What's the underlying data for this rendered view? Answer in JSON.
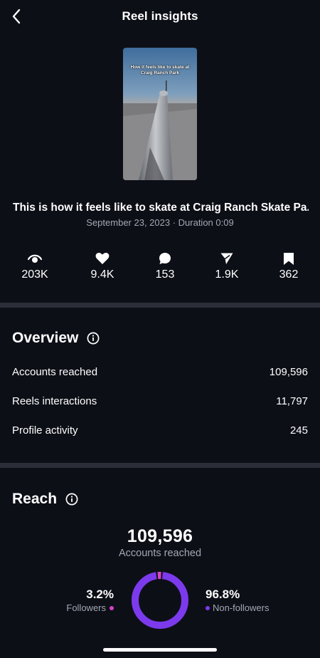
{
  "header": {
    "title": "Reel insights",
    "back_icon": "chevron-left-icon"
  },
  "reel": {
    "thumbnail_caption": "How it feels like to skate at Craig Ranch Park",
    "title": "This is how it feels like to skate at Craig Ranch Skate Pa...",
    "meta": "September 23, 2023 · Duration 0:09"
  },
  "stats": [
    {
      "icon": "eye-icon",
      "value": "203K"
    },
    {
      "icon": "heart-icon",
      "value": "9.4K"
    },
    {
      "icon": "comment-icon",
      "value": "153"
    },
    {
      "icon": "share-icon",
      "value": "1.9K"
    },
    {
      "icon": "bookmark-icon",
      "value": "362"
    }
  ],
  "overview": {
    "title": "Overview",
    "rows": [
      {
        "label": "Accounts reached",
        "value": "109,596"
      },
      {
        "label": "Reels interactions",
        "value": "11,797"
      },
      {
        "label": "Profile activity",
        "value": "245"
      }
    ]
  },
  "reach": {
    "title": "Reach",
    "total": "109,596",
    "total_label": "Accounts reached",
    "followers": {
      "pct": "3.2%",
      "label": "Followers",
      "fraction": 0.032,
      "color": "#d642c7"
    },
    "non_followers": {
      "pct": "96.8%",
      "label": "Non-followers",
      "fraction": 0.968,
      "color": "#7c3aed"
    }
  }
}
